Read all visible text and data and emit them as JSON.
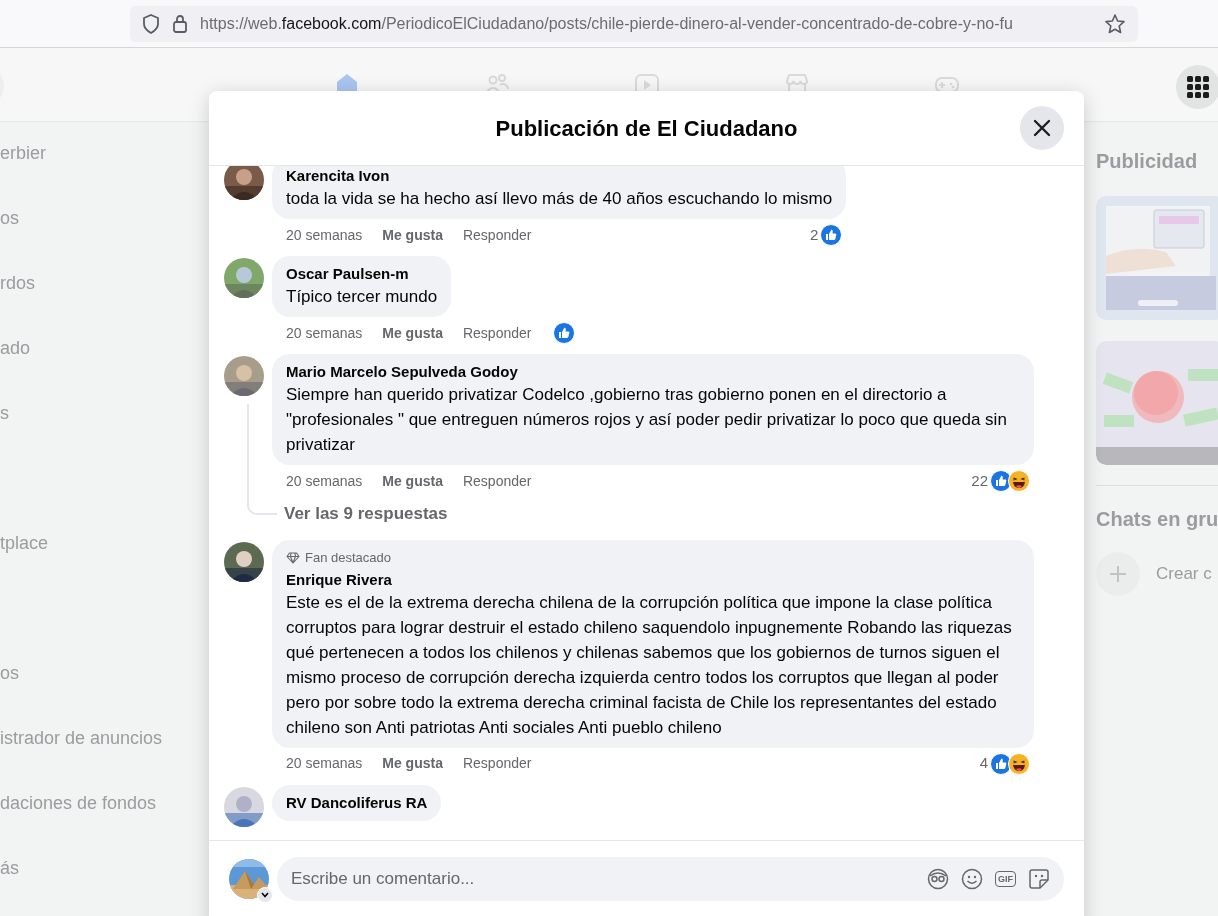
{
  "browser": {
    "url_prefix": "https://web.",
    "url_domain": "facebook.com",
    "url_rest": "/PeriodicoElCiudadano/posts/chile-pierde-dinero-al-vender-concentrado-de-cobre-y-no-fu"
  },
  "nav": {
    "tabs": [
      {
        "kind": "home",
        "selected": true
      },
      {
        "kind": "friends",
        "selected": false
      },
      {
        "kind": "video",
        "selected": false
      },
      {
        "kind": "marketplace",
        "selected": false
      },
      {
        "kind": "gaming",
        "selected": false
      }
    ]
  },
  "sidebar": {
    "groups": [
      [
        "erbier",
        "os",
        "rdos",
        "ado",
        "s"
      ],
      [
        "tplace"
      ],
      [
        "os",
        "istrador de anuncios",
        "daciones de fondos",
        "ás"
      ]
    ]
  },
  "right_column": {
    "ads_heading": "Publicidad",
    "chats_heading": "Chats en gru",
    "create_label": "Crear c"
  },
  "modal": {
    "title": "Publicación de El Ciudadano",
    "comments": [
      {
        "author": "Karencita Ivon",
        "text": "toda la vida se ha hecho así llevo más de 40 años escuchando lo mismo",
        "time": "20 semanas",
        "like": "Me gusta",
        "reply": "Responder",
        "reaction_count": "2",
        "reactions": [
          {
            "kind": "like"
          }
        ]
      },
      {
        "author": "Oscar Paulsen-m",
        "text": "Típico tercer mundo",
        "time": "20 semanas",
        "like": "Me gusta",
        "reply": "Responder",
        "reactions": [
          {
            "kind": "like"
          }
        ]
      },
      {
        "author": "Mario Marcelo Sepulveda Godoy",
        "text": "Siempre han querido privatizar Codelco ,gobierno tras gobierno ponen en el directorio a \"profesionales \" que entreguen números rojos y así poder pedir privatizar lo poco que queda sin privatizar",
        "time": "20 semanas",
        "like": "Me gusta",
        "reply": "Responder",
        "reaction_count": "22",
        "reactions": [
          {
            "kind": "like"
          },
          {
            "kind": "haha"
          }
        ],
        "replies_link": "Ver las 9 respuestas"
      },
      {
        "badge": "Fan destacado",
        "author": "Enrique Rivera",
        "text": "Este es el de la extrema derecha chilena de la corrupción política que impone la clase política corruptos para lograr destruir el estado chileno saquendolo inpugnemente Robando las riquezas qué pertenecen a todos los chilenos y chilenas sabemos que los gobiernos de turnos siguen el mismo proceso de corrupción derecha izquierda centro todos los corruptos que llegan al poder pero por sobre todo la extrema derecha criminal facista de Chile los representantes del estado chileno son Anti patriotas Anti sociales Anti pueblo chileno",
        "time": "20 semanas",
        "like": "Me gusta",
        "reply": "Responder",
        "reaction_count": "4",
        "reactions": [
          {
            "kind": "like"
          },
          {
            "kind": "haha"
          }
        ]
      },
      {
        "author": "RV Dancoliferus RA"
      }
    ],
    "composer": {
      "placeholder": "Escribe un comentario...",
      "gif_label": "GIF"
    }
  }
}
